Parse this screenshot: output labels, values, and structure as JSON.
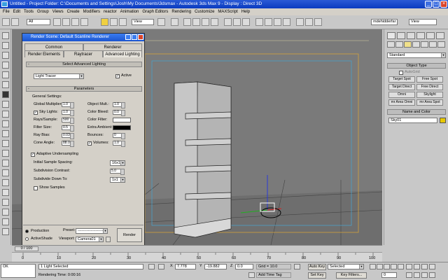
{
  "window": {
    "title": "Untitled   - Project Folder: C:\\Documents and Settings\\Josh\\My Documents\\3dsmax   - Autodesk 3ds Max 9   - Display : Direct 3D"
  },
  "menu": [
    "File",
    "Edit",
    "Tools",
    "Group",
    "Views",
    "Create",
    "Modifiers",
    "reactor",
    "Animation",
    "Graph Editors",
    "Rendering",
    "Customize",
    "MAXScript",
    "Help"
  ],
  "toolbar": {
    "selection_filter": "All",
    "reference_coord": "View",
    "named_selection": "mdehidderfar",
    "view_dropdown": "View"
  },
  "dialog": {
    "title": "Render Scene: Default Scanline Renderer",
    "tabs_row1": [
      "Common",
      "Renderer"
    ],
    "tabs_row2": [
      "Render Elements",
      "Raytracer",
      "Advanced Lighting"
    ],
    "select_rollout": "Select Advanced Lighting",
    "plugin": "Light Tracer",
    "active_label": "Active",
    "params_rollout": "Parameters",
    "general_settings": "General Settings:",
    "global_multiplier": {
      "label": "Global Multiplier:",
      "value": "1.0"
    },
    "object_mult": {
      "label": "Object Mult.:",
      "value": "1.0"
    },
    "sky_lights": {
      "label": "Sky Lights:",
      "value": "1.0"
    },
    "color_bleed": {
      "label": "Color Bleed:",
      "value": "0.0"
    },
    "rays_sample": {
      "label": "Rays/Sample:",
      "value": "500"
    },
    "color_filter": {
      "label": "Color Filter:"
    },
    "filter_size": {
      "label": "Filter Size:",
      "value": "0.5"
    },
    "extra_ambient": {
      "label": "Extra Ambient:"
    },
    "ray_bias": {
      "label": "Ray Bias:",
      "value": "0.03"
    },
    "bounces": {
      "label": "Bounces:",
      "value": "0"
    },
    "cone_angle": {
      "label": "Cone Angle:",
      "value": "88.0"
    },
    "volumes": {
      "label": "Volumes:",
      "value": "1.0"
    },
    "adaptive_label": "Adaptive Undersampling",
    "initial_spacing": {
      "label": "Initial Sample Spacing:",
      "value": "16x16"
    },
    "subdivision_contrast": {
      "label": "Subdivision Contrast:",
      "value": "5.0"
    },
    "subdivide_down": {
      "label": "Subdivide Down To:",
      "value": "1x1"
    },
    "show_samples": "Show Samples",
    "production": "Production",
    "activeshade": "ActiveShade",
    "preset_label": "Preset:",
    "preset_value": "--------------------",
    "viewport_label": "Viewport:",
    "viewport_value": "Camera01",
    "render_button": "Render"
  },
  "command_panel": {
    "category": "Standard",
    "object_type": "Object Type",
    "autogrid": "AutoGrid",
    "buttons": [
      "Target Spot",
      "Free Spot",
      "Target Direct",
      "Free Direct",
      "Omni",
      "Skylight",
      "mr Area Omni",
      "mr Area Spot"
    ],
    "name_and_color": "Name and Color",
    "object_name": "Sky01",
    "accent_color": "#e8c800"
  },
  "timeline": {
    "frame": "0 / 100",
    "ticks": [
      "0",
      "10",
      "20",
      "30",
      "40",
      "50",
      "60",
      "70",
      "80",
      "90",
      "100"
    ]
  },
  "status": {
    "selection": "1 Light Selected",
    "render_time": "Rendering Time: 0:00:16",
    "x": "7.778",
    "y": "-19.882",
    "z": "0.0",
    "grid": "Grid = 10.0",
    "add_time_tag": "Add Time Tag",
    "auto_key": "Auto Key",
    "set_key": "Set Key",
    "key_mode": "Selected",
    "key_filters": "Key Filters...",
    "frame_field": "0",
    "prompt": "OK",
    "x_label": "X",
    "y_label": "Y",
    "z_label": "Z"
  }
}
